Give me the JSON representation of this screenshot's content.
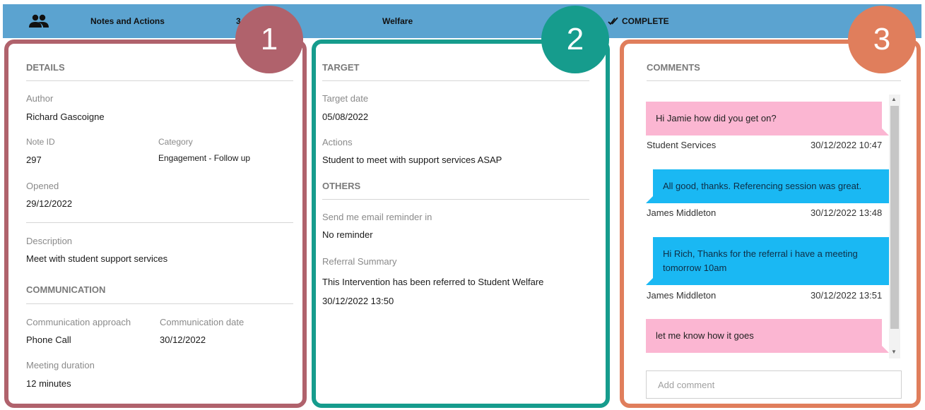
{
  "topbar": {
    "title": "Notes and Actions",
    "number": "3",
    "category": "Welfare",
    "status": "COMPLETE",
    "icons": {
      "people": "people-icon",
      "status": "double-check-icon"
    }
  },
  "badges": [
    "1",
    "2",
    "3"
  ],
  "details": {
    "section_title": "DETAILS",
    "author_label": "Author",
    "author": "Richard Gascoigne",
    "note_id_label": "Note ID",
    "note_id": "297",
    "category_label": "Category",
    "category": "Engagement - Follow up",
    "opened_label": "Opened",
    "opened": "29/12/2022",
    "description_label": "Description",
    "description": "Meet with student support services"
  },
  "communication": {
    "section_title": "COMMUNICATION",
    "approach_label": "Communication approach",
    "approach": "Phone Call",
    "date_label": "Communication date",
    "date": "30/12/2022",
    "duration_label": "Meeting duration",
    "duration": "12 minutes"
  },
  "target": {
    "section_title": "TARGET",
    "date_label": "Target date",
    "date": "05/08/2022",
    "actions_label": "Actions",
    "actions": "Student to meet with support services ASAP"
  },
  "others": {
    "section_title": "OTHERS",
    "reminder_label": "Send me email reminder in",
    "reminder": "No reminder",
    "referral_label": "Referral Summary",
    "referral_text": "This Intervention has been referred to Student Welfare",
    "referral_date": "30/12/2022 13:50"
  },
  "comments": {
    "section_title": "COMMENTS",
    "placeholder": "Add comment",
    "messages": [
      {
        "text": "Hi Jamie how did you get on?",
        "author": "Student Services",
        "time": "30/12/2022 10:47",
        "color": "#fbb6d2"
      },
      {
        "text": "All good, thanks. Referencing session was great.",
        "author": "James Middleton",
        "time": "30/12/2022 13:48",
        "color": "#1ab8f3"
      },
      {
        "text": "Hi Rich, Thanks for the referral i have a meeting tomorrow 10am",
        "author": "James Middleton",
        "time": "30/12/2022 13:51",
        "color": "#1ab8f3"
      },
      {
        "text": "let me know how it goes",
        "color": "#fbb6d2"
      }
    ]
  },
  "colors": {
    "topbar": "#5ba3d0",
    "panel1": "#b0626c",
    "panel2": "#169c8d",
    "panel3": "#e07e5c"
  }
}
